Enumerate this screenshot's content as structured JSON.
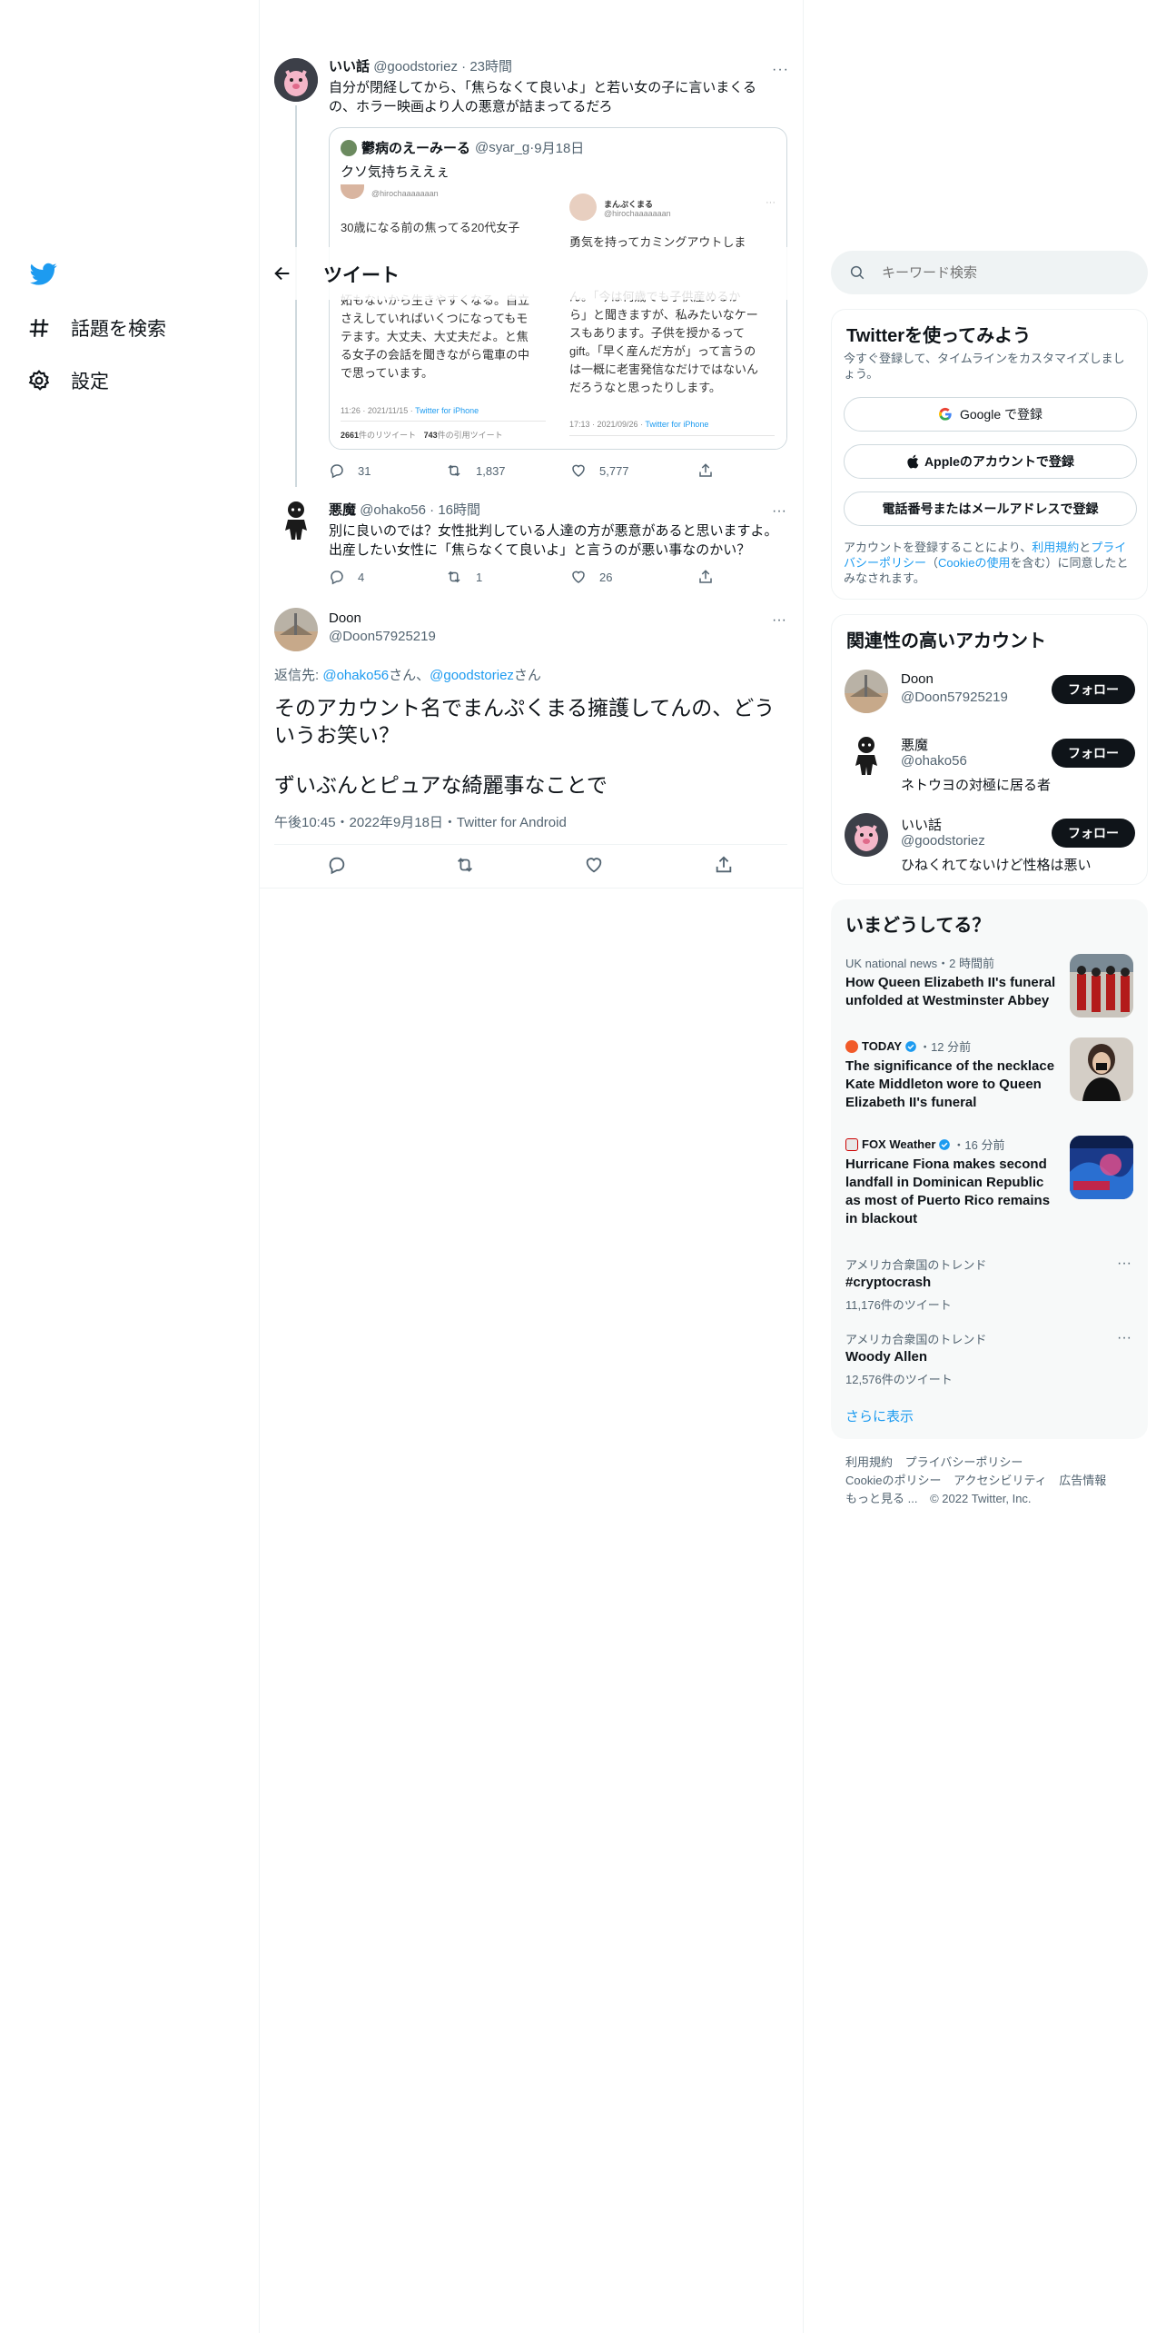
{
  "nav": {
    "explore_label": "話題を検索",
    "settings_label": "設定"
  },
  "header": {
    "back_icon": "arrow-left-icon",
    "title": "ツイート"
  },
  "tweet1": {
    "name": "いい話",
    "handle": "@goodstoriez",
    "time": "23時間",
    "text": "自分が閉経してから、「焦らなくて良いよ」と若い女の子に言いまくるの、ホラー映画より人の悪意が詰まってるだろ",
    "quote": {
      "name": "鬱病のえーみーる",
      "handle": "@syar_g",
      "date": "9月18日",
      "text": "クソ気持ちええぇ",
      "left_image": {
        "handle": "@hirochaaaaaaan",
        "lines": [
          "30歳になる前の焦ってる20代女子",
          "",
          "",
          "",
          "妬もないから生きやすくなる。自立",
          "さえしていればいくつになってもモ",
          "テます。大丈夫、大丈夫だよ。と焦",
          "る女子の会話を聞きながら電車の中",
          "で思っています。"
        ],
        "time": "11:26 · 2021/11/15 · ",
        "client": "Twitter for iPhone",
        "rt_count": "2661",
        "rt_label": "件のリツイート",
        "qt_count": "743",
        "qt_label": "件の引用ツイート"
      },
      "right_image": {
        "name": "まんぷくまる",
        "handle": "@hirochaaaaaaan",
        "lines": [
          "勇気を持ってカミングアウトしま",
          "",
          "",
          "ん。「今は何歳でも子供産めるか",
          "ら」と聞きますが、私みたいなケー",
          "スもあります。子供を授かるって",
          "gift。「早く産んだ方が」って言うの",
          "は一概に老害発信なだけではないん",
          "だろうなと思ったりします。"
        ],
        "time": "17:13 · 2021/09/26 · ",
        "client": "Twitter for iPhone"
      }
    },
    "replies": "31",
    "retweets": "1,837",
    "likes": "5,777"
  },
  "tweet2": {
    "name": "悪魔",
    "handle": "@ohako56",
    "time": "16時間",
    "text": "別に良いのでは？女性批判している人達の方が悪意があると思いますよ。出産したい女性に「焦らなくて良いよ」と言うのが悪い事なのかい？",
    "replies": "4",
    "retweets": "1",
    "likes": "26"
  },
  "main_tweet": {
    "name": "Doon",
    "handle": "@Doon57925219",
    "reply_prefix": "返信先: ",
    "reply_user1": "@ohako56",
    "reply_san1": "さん、",
    "reply_user2": "@goodstoriez",
    "reply_san2": "さん",
    "text_line1": "そのアカウント名でまんぷくまる擁護してんの、どういうお笑い？",
    "text_line2": "ずいぶんとピュアな綺麗事なことで",
    "meta": "午後10:45・2022年9月18日・Twitter for Android"
  },
  "search": {
    "placeholder": "キーワード検索"
  },
  "signup": {
    "title": "Twitterを使ってみよう",
    "subtitle": "今すぐ登録して、タイムラインをカスタマイズしましょう。",
    "google": "Google で登録",
    "apple": "Appleのアカウントで登録",
    "phone": "電話番号またはメールアドレスで登録",
    "terms_pre": "アカウントを登録することにより、",
    "terms_link": "利用規約",
    "terms_mid": "と",
    "privacy_link": "プライバシーポリシー",
    "cookie_pre": "（",
    "cookie_link": "Cookieの使用",
    "cookie_post": "を含む）に同意したとみなされます。"
  },
  "related": {
    "title": "関連性の高いアカウント",
    "follow_label": "フォロー",
    "accounts": [
      {
        "name": "Doon",
        "handle": "@Doon57925219",
        "bio": ""
      },
      {
        "name": "悪魔",
        "handle": "@ohako56",
        "bio": "ネトウヨの対極に居る者"
      },
      {
        "name": "いい話",
        "handle": "@goodstoriez",
        "bio": "ひねくれてないけど性格は悪い"
      }
    ]
  },
  "trends": {
    "title": "いまどうしてる？",
    "items": [
      {
        "meta": "UK national news・2 時間前",
        "title": "How Queen Elizabeth II's funeral unfolded at Westminster Abbey"
      },
      {
        "source": "TODAY",
        "time": "・12 分前",
        "title": "The significance of the necklace Kate Middleton wore to Queen Elizabeth II's funeral"
      },
      {
        "source": "FOX Weather",
        "time": "・16 分前",
        "title": "Hurricane Fiona makes second landfall in Dominican Republic as most of Puerto Rico remains in blackout"
      },
      {
        "meta": "アメリカ合衆国のトレンド",
        "title": "#cryptocrash",
        "count": "11,176件のツイート"
      },
      {
        "meta": "アメリカ合衆国のトレンド",
        "title": "Woody Allen",
        "count": "12,576件のツイート"
      }
    ],
    "show_more": "さらに表示"
  },
  "footer": {
    "terms": "利用規約",
    "privacy": "プライバシーポリシー",
    "cookie": "Cookieのポリシー",
    "accessibility": "アクセシビリティ",
    "ads": "広告情報",
    "more": "もっと見る ...",
    "copyright": "© 2022 Twitter, Inc."
  },
  "colors": {
    "accent": "#1d9bf0",
    "text": "#0f1419",
    "muted": "#536471",
    "border": "#eff3f4"
  }
}
